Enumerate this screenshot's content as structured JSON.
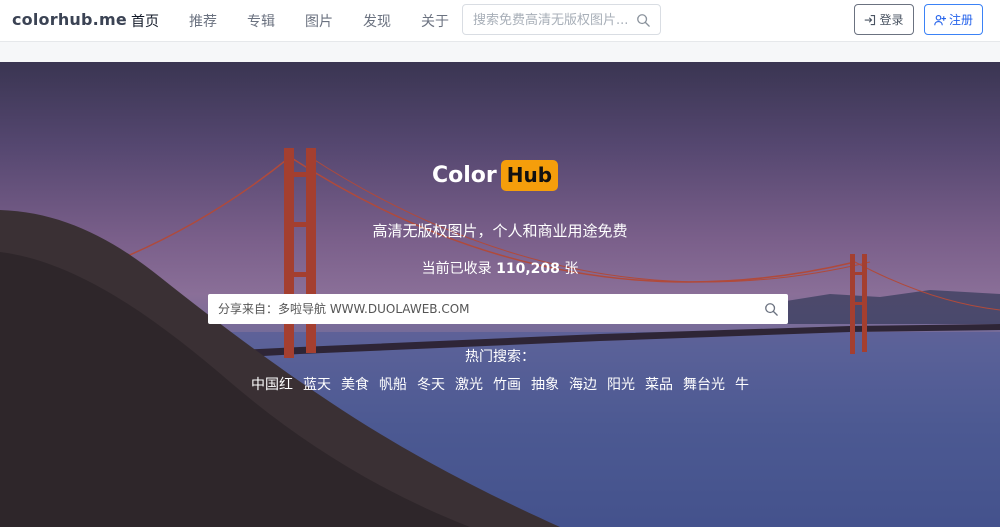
{
  "navbar": {
    "brand": "colorhub.me",
    "links": [
      {
        "label": "首页",
        "active": true
      },
      {
        "label": "推荐",
        "active": false
      },
      {
        "label": "专辑",
        "active": false
      },
      {
        "label": "图片",
        "active": false
      },
      {
        "label": "发现",
        "active": false
      },
      {
        "label": "关于",
        "active": false
      }
    ],
    "search": {
      "placeholder": "搜索免费高清无版权图片...",
      "icon": "search-icon"
    },
    "login_label": "登录",
    "signup_label": "注册"
  },
  "hero": {
    "logo": {
      "text": "Color",
      "badge": "Hub",
      "badge_color": "#f59e0b"
    },
    "tagline": "高清无版权图片，个人和商业用途免费",
    "count_prefix": "当前已收录 ",
    "count_value": "110,208",
    "count_suffix": " 张",
    "search": {
      "placeholder": "分享来自：多啦导航 WWW.DUOLAWEB.COM",
      "icon": "search-icon"
    },
    "hot_title": "热门搜索：",
    "hot_tags": [
      "中国红",
      "蓝天",
      "美食",
      "帆船",
      "冬天",
      "激光",
      "竹画",
      "抽象",
      "海边",
      "阳光",
      "菜品",
      "舞台光",
      "牛"
    ]
  },
  "colors": {
    "accent_blue": "#3b82f6",
    "bridge_red": "#c0392b"
  }
}
